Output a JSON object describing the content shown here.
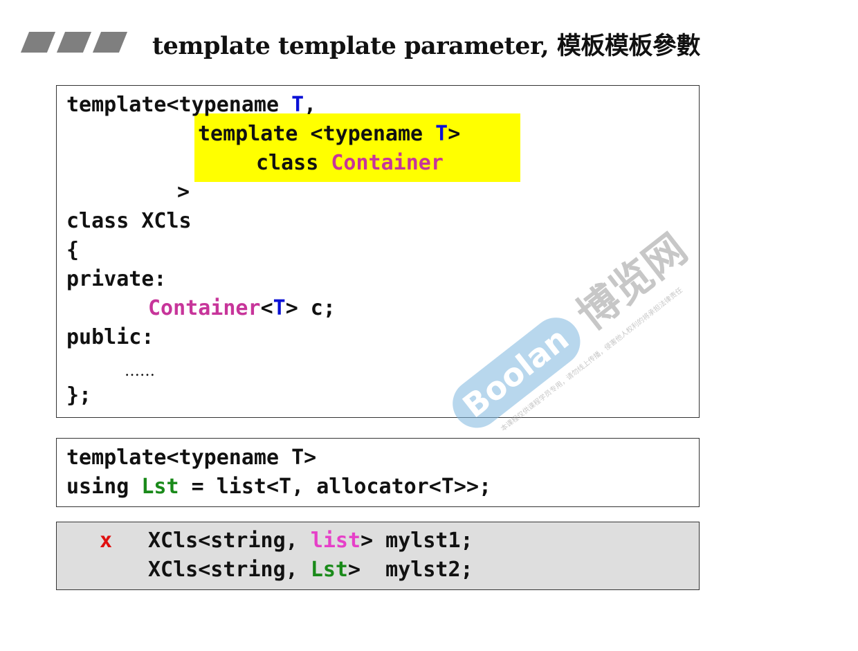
{
  "header": {
    "title": "template template parameter, 模板模板參數"
  },
  "code_box_1": {
    "lines": [
      {
        "parts": [
          "template<typename ",
          "T",
          ","
        ]
      },
      {
        "parts": [
          "template <typename ",
          "T",
          ">"
        ]
      },
      {
        "parts": [
          "class ",
          "Container"
        ]
      },
      {
        "parts": [
          ">"
        ]
      },
      {
        "parts": [
          "class XCls"
        ]
      },
      {
        "parts": [
          "{"
        ]
      },
      {
        "parts": [
          "private:"
        ]
      },
      {
        "parts": [
          "Container",
          "<",
          "T",
          "> c;"
        ]
      },
      {
        "parts": [
          "public:"
        ]
      },
      {
        "parts": [
          "……"
        ]
      },
      {
        "parts": [
          "};"
        ]
      }
    ]
  },
  "code_box_2": {
    "lines": [
      {
        "parts": [
          "template<typename T>"
        ]
      },
      {
        "parts": [
          "using ",
          "Lst",
          " = list<T, allocator<T>>;"
        ]
      }
    ]
  },
  "code_box_3": {
    "mark": "x",
    "lines": [
      {
        "parts": [
          "XCls<string, ",
          "list",
          "> mylst1;"
        ]
      },
      {
        "parts": [
          "XCls<string, ",
          "Lst",
          ">  mylst2;"
        ]
      }
    ]
  },
  "watermark": {
    "brand": "Boolan",
    "cn_name": "博览网",
    "notice": "本课程仅供课程学员专用，请勿线上传播，侵害他人权利的将承担法律责任"
  },
  "colors": {
    "type_param": "#0a10d6",
    "template_name": "#c7359a",
    "alias": "#1a8a1a",
    "error_mark": "#e01010",
    "highlight": "#ffff00"
  }
}
